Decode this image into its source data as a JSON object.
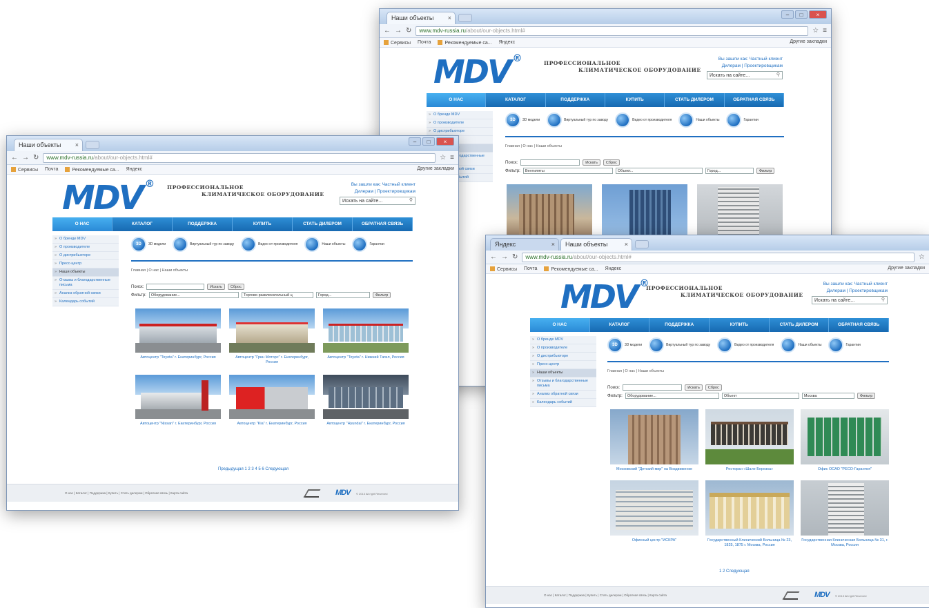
{
  "browser": {
    "tab_title": "Наши объекты",
    "tab_title_2": "Яндекс",
    "url_host": "www.mdv-russia.ru",
    "url_path": "/about/our-objects.html#",
    "bookmarks": [
      "Сервисы",
      "Почта",
      "Рекомендуемые са...",
      "Яндекс"
    ],
    "other_bookmarks": "Другие закладки"
  },
  "site": {
    "logo": "MDV",
    "logo_mark": "®",
    "tagline_1": "ПРОФЕССИОНАЛЬНОЕ",
    "tagline_2": "КЛИМАТИЧЕСКОЕ ОБОРУДОВАНИЕ",
    "user_line": "Вы зашли как: Частный клиент",
    "user_links": "Дилерам | Проектировщикам",
    "search_placeholder": "Искать на сайте...",
    "menu": [
      "О НАС",
      "КАТАЛОГ",
      "ПОДДЕРЖКА",
      "КУПИТЬ",
      "СТАТЬ ДИЛЕРОМ",
      "ОБРАТНАЯ СВЯЗЬ"
    ],
    "sidebar": [
      "О бренде MDV",
      "О производителе",
      "О дистрибьюторе",
      "Пресс-центр",
      "Наши объекты",
      "Отзывы и благодарственные письма",
      "Анализ обратной связи",
      "Календарь событий"
    ],
    "icons": [
      "3D модели",
      "Виртуальный тур по заводу",
      "Видео от производителя",
      "Наши объекты",
      "Гарантии"
    ],
    "breadcrumb": "Главная | О нас | Наши объекты",
    "search_label": "Поиск:",
    "search_button": "Искать",
    "reset_button": "Сброс",
    "filter_label": "Фильтр:",
    "filter_button": "Фильтр",
    "footer_links": "О нас | Каталог | Поддержка | Купить | Стать дилером | Обратная связь | Карта сайта",
    "footer_logo": "MDV",
    "footer_copy": "© 2013 All right Reserved"
  },
  "window_left": {
    "filters": [
      "Оборудование...",
      "Торгово-развлекательный ц",
      "Город..."
    ],
    "items": [
      "Автоцентр \"Toyota\" г. Екатеринбург, Россия",
      "Автоцентр \"Грин Моторс\" г. Екатеринбург, Россия",
      "Автоцентр \"Toyota\" г. Нижний Тагил, Россия",
      "Автоцентр \"Nissan\" г. Екатеринбург, Россия",
      "Автоцентр \"Kia\" г. Екатеринбург, Россия",
      "Автоцентр \"Hyundai\" г. Екатеринбург, Россия"
    ],
    "pager": "Предыдущая 1 2 3 4 5 6 Следующая"
  },
  "window_top": {
    "filters": [
      "Вентиляты",
      "Объект...",
      "Город..."
    ]
  },
  "window_right": {
    "filters": [
      "Оборудование...",
      "Объект",
      "Москва"
    ],
    "items": [
      "Московский \"Детский мир\" на Воздвиженке",
      "Ресторан «Шале Березка»",
      "Офис ОСАО \"РЕСО-Гарантия\"",
      "Офисный центр \"ИСКРА\"",
      "Государственный Клинический Больница № 23, 1825, 1875 г. Москва, Россия",
      "Государственная Клиническая Больница № 31, г. Москва, Россия"
    ],
    "pager": "1 2 Следующая"
  },
  "colors": {
    "brand": "#1f6fc1",
    "menu": "#1769b1"
  }
}
